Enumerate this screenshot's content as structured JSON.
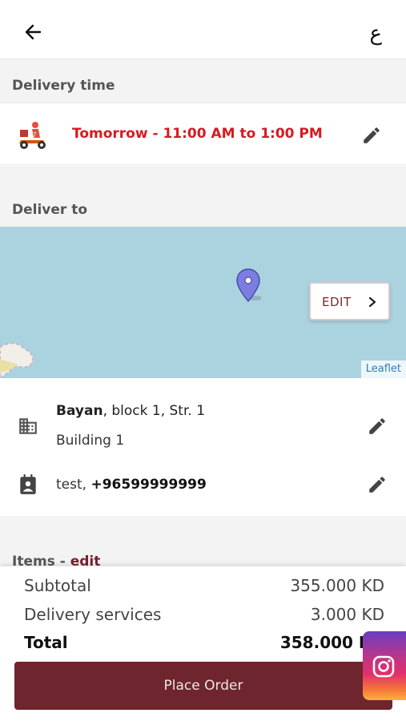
{
  "header": {
    "lang_label": "ع"
  },
  "delivery_time": {
    "section_label": "Delivery time",
    "value": "Tomorrow - 11:00 AM to 1:00 PM"
  },
  "deliver_to": {
    "section_label": "Deliver to",
    "map_edit_label": "EDIT",
    "map_attribution": "Leaflet",
    "address_area": "Bayan",
    "address_rest": ", block 1, Str. 1",
    "address_line2": "Building 1",
    "contact_name": "test, ",
    "contact_phone": "+96599999999"
  },
  "items": {
    "label": "Items - ",
    "edit_label": "edit"
  },
  "summary": {
    "subtotal_label": "Subtotal",
    "subtotal_value": "355.000 KD",
    "delivery_label": "Delivery services",
    "delivery_value": "3.000 KD",
    "total_label": "Total",
    "total_value": "358.000 KD"
  },
  "place_order_label": "Place Order",
  "colors": {
    "accent": "#6f252d",
    "delivery_text": "#d71920",
    "map": "#aad3df"
  }
}
